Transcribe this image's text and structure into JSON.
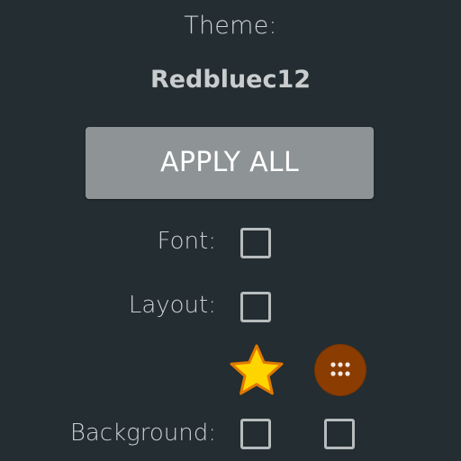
{
  "theme": {
    "label": "Theme:",
    "name": "Redbluec12"
  },
  "apply_button": {
    "label": "APPLY ALL"
  },
  "options": {
    "font": {
      "label": "Font:",
      "checked": false
    },
    "layout": {
      "label": "Layout:",
      "checked": false
    },
    "background": {
      "label": "Background:",
      "checkbox_1_checked": false,
      "checkbox_2_checked": false
    }
  },
  "icons": {
    "star": "star-icon",
    "apps": "app-drawer-icon"
  },
  "colors": {
    "background": "#232d32",
    "button": "#8e9495",
    "star": "#ffd500",
    "apps_circle": "#7a3500"
  }
}
